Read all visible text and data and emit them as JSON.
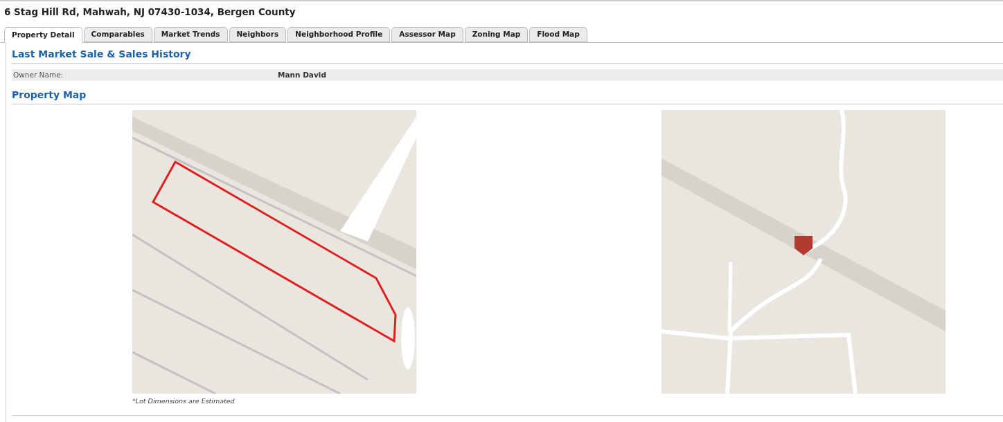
{
  "title": "6 Stag Hill Rd, Mahwah, NJ 07430-1034, Bergen County",
  "tabs": [
    {
      "label": "Property Detail",
      "selected": true
    },
    {
      "label": "Comparables",
      "selected": false
    },
    {
      "label": "Market Trends",
      "selected": false
    },
    {
      "label": "Neighbors",
      "selected": false
    },
    {
      "label": "Neighborhood Profile",
      "selected": false
    },
    {
      "label": "Assessor Map",
      "selected": false
    },
    {
      "label": "Zoning Map",
      "selected": false
    },
    {
      "label": "Flood Map",
      "selected": false
    }
  ],
  "sales_section": {
    "heading": "Last Market Sale & Sales History",
    "rows": [
      {
        "label": "Owner Name:",
        "value": "Mann David"
      }
    ]
  },
  "map_section": {
    "heading": "Property Map",
    "maps": [
      {
        "kind": "lot"
      },
      {
        "kind": "road"
      }
    ],
    "caption": "*Lot Dimensions are Estimated"
  }
}
